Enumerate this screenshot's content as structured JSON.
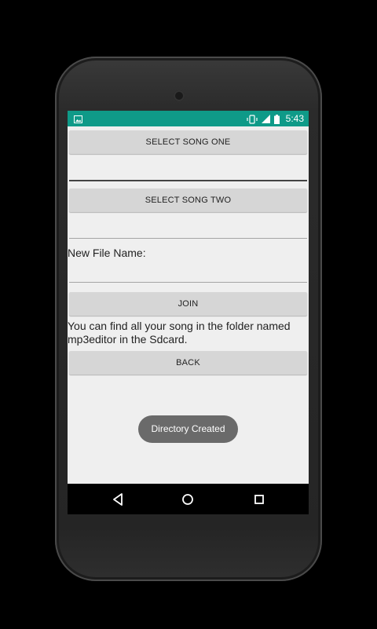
{
  "status_bar": {
    "time": "5:43",
    "icons": [
      "image-icon",
      "vibrate-icon",
      "signal-icon",
      "battery-icon"
    ]
  },
  "buttons": {
    "select_song_one": "SELECT SONG ONE",
    "select_song_two": "SELECT SONG TWO",
    "join": "JOIN",
    "back": "BACK"
  },
  "fields": {
    "song_one_value": "",
    "song_two_value": "",
    "new_file_name_value": ""
  },
  "labels": {
    "new_file_name": "New File Name:",
    "info": "You can find all your song in the folder named mp3editor in the Sdcard."
  },
  "toast": {
    "text": "Directory Created"
  },
  "nav": {
    "icons": [
      "back-icon",
      "home-icon",
      "recents-icon"
    ]
  },
  "colors": {
    "status_bar": "#0f9a88",
    "screen_bg": "#efefef",
    "button_bg": "#d6d6d6",
    "toast_bg": "#6a6a6a"
  }
}
